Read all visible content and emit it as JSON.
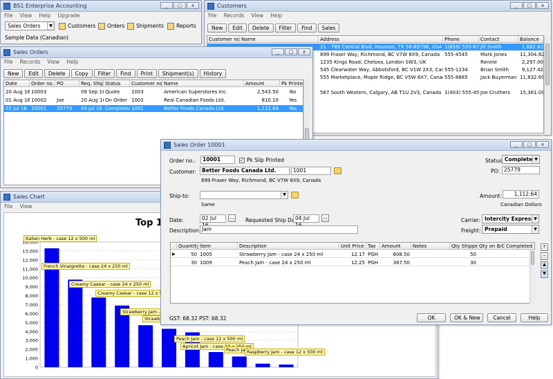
{
  "bs1": {
    "title": "BS1 Enterprise Accounting",
    "menu": [
      "File",
      "View",
      "Help",
      "Upgrade"
    ],
    "module_select": "Sales Orders",
    "nav": [
      "Customers",
      "Orders",
      "Shipments",
      "Reports"
    ],
    "company": "Sample Data (Canadian)"
  },
  "customers": {
    "title": "Customers",
    "menu": [
      "File",
      "Records",
      "View",
      "Help"
    ],
    "toolbar": [
      "New",
      "Edit",
      "Delete",
      "Filter",
      "Find",
      "Sales"
    ],
    "columns": [
      "Customer no.",
      "Name",
      "Address",
      "Phone",
      "Contact",
      "Balance"
    ],
    "rows": [
      {
        "address": "21 - 789 Central Blvd, Houston, TX  58-85796, USA",
        "phone": "1(859) 555-6789",
        "contact": "Jill Smith",
        "balance": "1,662.82"
      },
      {
        "address": "899 Fraser Way, Richmond, BC  V7W 8X9, Canada",
        "phone": "555-4545",
        "contact": "Mark Jones",
        "balance": "11,304.82"
      },
      {
        "address": "1235 Kings Road, Chelsea, London  SW3, UK",
        "phone": "",
        "contact": "Ronnie",
        "balance": "2,297.00"
      },
      {
        "address": "545 Clearwater Way, Abbotsford, BC  V1W 2X3, Canada",
        "phone": "555-1234",
        "contact": "Brian Smith",
        "balance": "9,127.42"
      },
      {
        "address": "555 Marketplace, Maple Ridge, BC  V5W 6X7, Canada",
        "phone": "555-8885",
        "contact": "Jack Buyerman",
        "balance": "11,832.69"
      },
      {
        "address": "",
        "phone": "",
        "contact": "",
        "balance": ""
      },
      {
        "address": "567 South Western, Calgary, AB  T1U 2V3, Canada",
        "phone": "1(403) 555-4567",
        "contact": "Joe Cruthers",
        "balance": "15,361.09"
      }
    ]
  },
  "sales_orders": {
    "title": "Sales Orders",
    "menu": [
      "File",
      "Records",
      "View",
      "Help"
    ],
    "toolbar": [
      "New",
      "Edit",
      "Delete",
      "Copy",
      "Filter",
      "Find",
      "Print",
      "Shipment(s)",
      "History"
    ],
    "columns": [
      "Date",
      "Order no.",
      "PO",
      "Req. Ship",
      "Status",
      "Customer no.",
      "Name",
      "Amount",
      "Pk Printed"
    ],
    "rows": [
      {
        "date": "20 Aug 16",
        "order": "10003",
        "po": "",
        "req": "09 Sep 16",
        "status": "Quote",
        "cust": "1003",
        "name": "American Superstores Inc.",
        "amount": "2,543.50",
        "pk": "No"
      },
      {
        "date": "01 Aug 16",
        "order": "10002",
        "po": "Joe",
        "req": "20 Aug 16",
        "status": "On Order",
        "cust": "1002",
        "name": "Real Canadian Foods Ltd.",
        "amount": "810.10",
        "pk": "Yes"
      },
      {
        "date": "02 Jul 16",
        "order": "10001",
        "po": "25779",
        "req": "04 Jul 16",
        "status": "Completed",
        "cust": "1001",
        "name": "Better Foods Canada Ltd.",
        "amount": "1,112.64",
        "pk": "Yes"
      }
    ]
  },
  "sales_chart": {
    "title": "Sales Chart",
    "menu": [
      "File",
      "View"
    ],
    "heading": "Top 10"
  },
  "chart_data": {
    "type": "bar",
    "title": "Top 10",
    "ylim": [
      0,
      14000
    ],
    "yticks": [
      "0",
      "1,000",
      "2,000",
      "3,000",
      "4,000",
      "5,000",
      "6,000",
      "7,000",
      "8,000",
      "9,000",
      "10,000",
      "11,000",
      "12,000",
      "13,000",
      "14,000"
    ],
    "categories": [
      "Italian Herb - case 12 x 500 ml",
      "French Vinaigrette - case 24 x 250 ml",
      "Creamy Caesar - case 24 x 250 ml",
      "Creamy Caesar - case 12 x 500 ml",
      "Strawberry Jam - c",
      "Strawb",
      "Peach Jam - case 12 x 500 ml",
      "Apricot Jam - case 24 x 250 ml",
      "Peach Ja",
      "Raspberry Jam - case 12 x 500 ml"
    ],
    "values": [
      13300,
      9800,
      7800,
      6900,
      4700,
      4300,
      3900,
      1700,
      1200,
      400,
      300
    ],
    "color": "#0000ee"
  },
  "order": {
    "title": "Sales Order 10001",
    "order_label": "Order no.:",
    "order_no": "10001",
    "pk_label": "Pk Slip Printed",
    "status_label": "Status:",
    "status": "Completed",
    "po_label": "PO:",
    "po": "25779",
    "customer_label": "Customer:",
    "customer": "Better Foods Canada Ltd.",
    "customer_no": "1001",
    "customer_address": "899 Fraser Way, Richmond, BC  V7W 8X9, Canada",
    "shipto_label": "Ship-to:",
    "shipto_same": "Same",
    "amount_label": "Amount:",
    "amount": "1,112.64",
    "currency": "Canadian Dollars",
    "date_label": "Date:",
    "date": "02 Jul 16",
    "req_label": "Requested Ship Date:",
    "req_date": "04 Jul 16",
    "carrier_label": "Carrier:",
    "carrier": "Intercity Express",
    "freight_label": "Freight:",
    "freight": "Prepaid",
    "desc_label": "Description:",
    "description": "Jam",
    "columns": [
      "Quantity",
      "Item",
      "Description",
      "Unit Price",
      "Tax",
      "Amount",
      "Notes",
      "Qty Shipped",
      "Qty on B/O",
      "Completed"
    ],
    "lines": [
      {
        "qty": "50",
        "item": "1005",
        "desc": "Strawberry Jam - case 24 x 250 ml",
        "price": "12.17",
        "tax": "PGH",
        "amount": "608.50",
        "notes": "",
        "shipped": "50",
        "bo": "",
        "done": ""
      },
      {
        "qty": "30",
        "item": "1009",
        "desc": "Peach Jam - case 24 x 250 ml",
        "price": "12.25",
        "tax": "PGH",
        "amount": "367.50",
        "notes": "",
        "shipped": "30",
        "bo": "",
        "done": ""
      }
    ],
    "gst": "GST: 68.32",
    "pst": "PST: 68.32",
    "buttons": [
      "OK",
      "OK & New",
      "Cancel",
      "Help"
    ]
  }
}
